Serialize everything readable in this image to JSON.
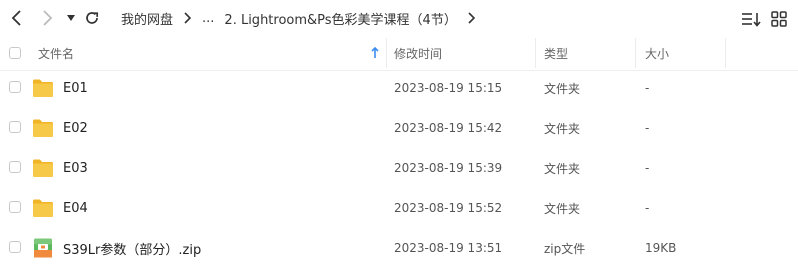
{
  "toolbar": {
    "back_icon": "chevron-left-icon",
    "forward_icon": "chevron-right-icon",
    "history_icon": "caret-down-icon",
    "refresh_icon": "refresh-icon",
    "sort_icon": "sort-list-icon",
    "grid_icon": "grid-view-icon"
  },
  "breadcrumb": {
    "root": "我的网盘",
    "ellipsis": "...",
    "current": "2. Lightroom&Ps色彩美学课程（4节）"
  },
  "columns": {
    "name": "文件名",
    "modified": "修改时间",
    "type": "类型",
    "size": "大小"
  },
  "files": [
    {
      "name": "E01",
      "modified": "2023-08-19 15:15",
      "type": "文件夹",
      "size": "-",
      "icon": "folder-icon"
    },
    {
      "name": "E02",
      "modified": "2023-08-19 15:42",
      "type": "文件夹",
      "size": "-",
      "icon": "folder-icon"
    },
    {
      "name": "E03",
      "modified": "2023-08-19 15:39",
      "type": "文件夹",
      "size": "-",
      "icon": "folder-icon"
    },
    {
      "name": "E04",
      "modified": "2023-08-19 15:52",
      "type": "文件夹",
      "size": "-",
      "icon": "folder-icon"
    },
    {
      "name": "S39Lr参数（部分）.zip",
      "modified": "2023-08-19 13:51",
      "type": "zip文件",
      "size": "19KB",
      "icon": "zip-archive-icon"
    }
  ],
  "colors": {
    "folder": "#f7c948",
    "folder_dark": "#f0b429",
    "sort_arrow": "#3b8cf3",
    "zip_green": "#5cb85c",
    "zip_orange": "#f08a3c"
  }
}
